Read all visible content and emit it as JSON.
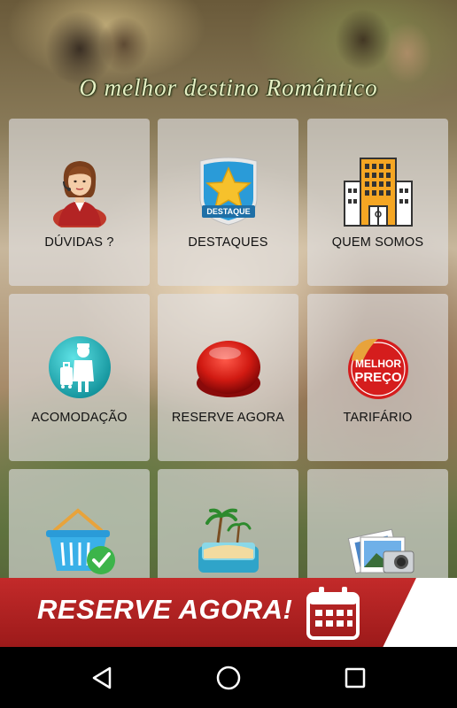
{
  "header": {
    "slogan": "O melhor destino Romântico"
  },
  "tiles": [
    {
      "label": "DÚVIDAS ?",
      "icon": "receptionist-icon"
    },
    {
      "label": "DESTAQUES",
      "icon": "star-badge-icon",
      "badge_text": "DESTAQUE"
    },
    {
      "label": "QUEM SOMOS",
      "icon": "building-icon"
    },
    {
      "label": "ACOMODAÇÃO",
      "icon": "bellboy-icon"
    },
    {
      "label": "RESERVE AGORA",
      "icon": "red-button-icon"
    },
    {
      "label": "TARIFÁRIO",
      "icon": "best-price-sticker-icon",
      "sticker_line1": "MELHOR",
      "sticker_line2": "PREÇO"
    },
    {
      "label": "",
      "icon": "basket-check-icon"
    },
    {
      "label": "",
      "icon": "suitcase-beach-icon"
    },
    {
      "label": "",
      "icon": "photos-camera-icon"
    }
  ],
  "banner": {
    "text": "RESERVE AGORA!",
    "icon": "calendar-icon",
    "color": "#b02222"
  },
  "navbar": {
    "back": "back-icon",
    "home": "home-icon",
    "recents": "recents-icon"
  }
}
